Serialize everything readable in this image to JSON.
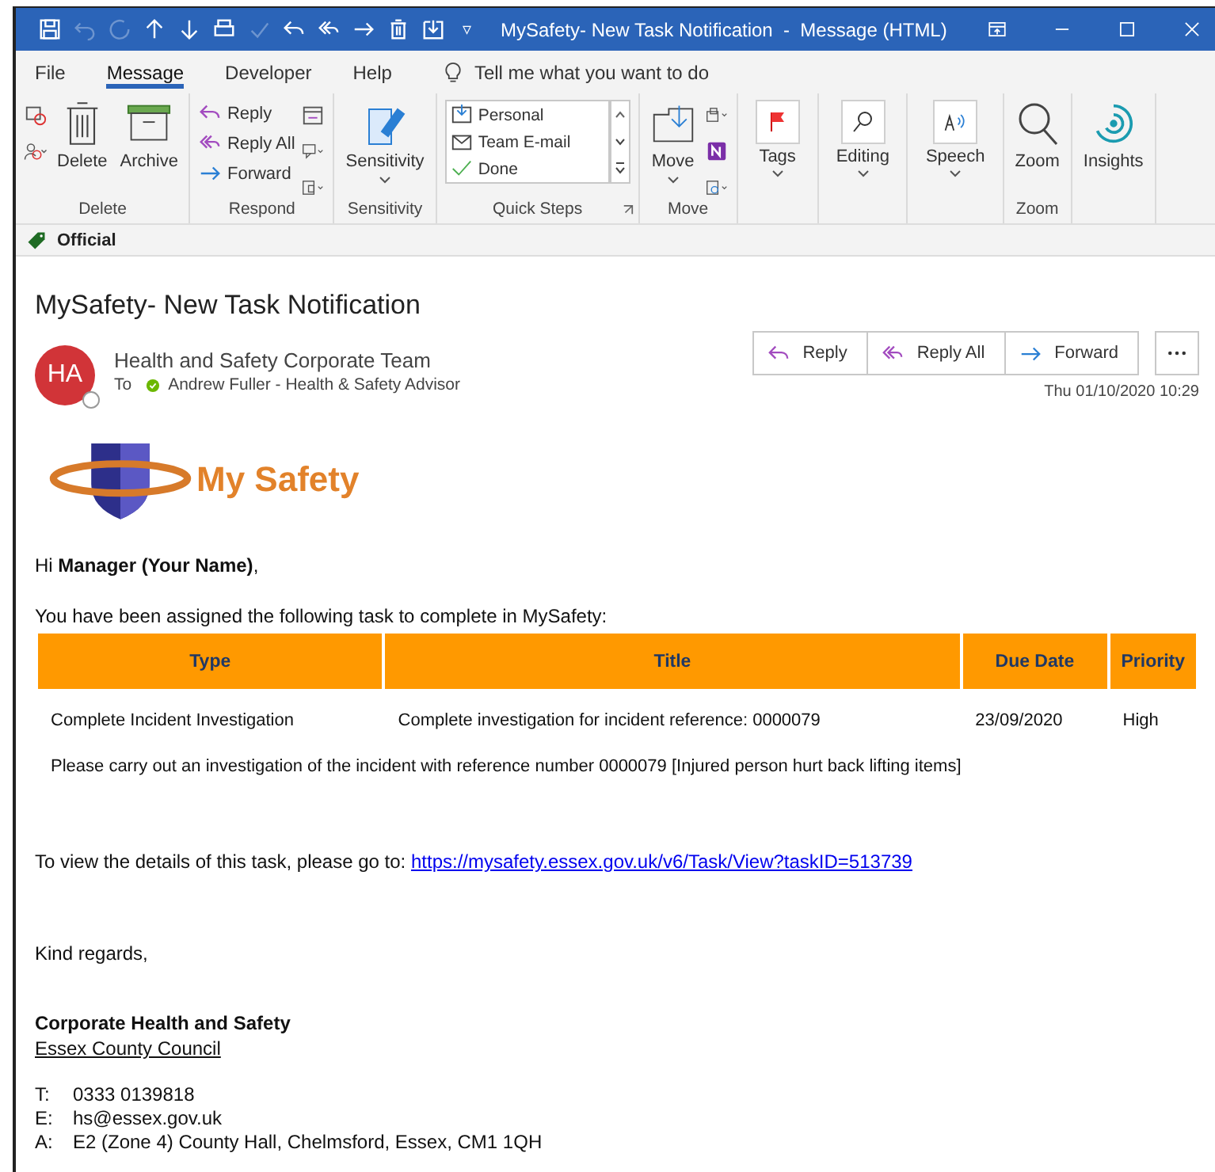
{
  "window": {
    "title": "MySafety- New Task Notification  -  Message (HTML)",
    "qat_more": "▿"
  },
  "menu_tabs": [
    {
      "label": "File",
      "selected": false
    },
    {
      "label": "Message",
      "selected": true
    },
    {
      "label": "Developer",
      "selected": false
    },
    {
      "label": "Help",
      "selected": false
    }
  ],
  "tell_me": {
    "placeholder": "Tell me what you want to do"
  },
  "ribbon": {
    "groups": [
      {
        "label": "Delete",
        "kind": "delete",
        "buttons": [
          "Delete",
          "Archive"
        ]
      },
      {
        "label": "Respond",
        "kind": "respond",
        "buttons": [
          "Reply",
          "Reply All",
          "Forward"
        ]
      },
      {
        "label": "Sensitivity",
        "kind": "big",
        "buttons": [
          "Sensitivity"
        ]
      },
      {
        "label": "Quick Steps",
        "kind": "quicksteps",
        "buttons": [
          "Personal",
          "Team E-mail",
          "Done"
        ]
      },
      {
        "label": "Move",
        "kind": "move",
        "buttons": [
          "Move"
        ]
      },
      {
        "kind": "small",
        "buttons": [
          "Tags"
        ]
      },
      {
        "kind": "small",
        "buttons": [
          "Editing"
        ]
      },
      {
        "kind": "small",
        "buttons": [
          "Speech"
        ]
      },
      {
        "label": "Zoom",
        "kind": "big",
        "buttons": [
          "Zoom"
        ]
      },
      {
        "kind": "big",
        "buttons": [
          "Insights"
        ]
      }
    ]
  },
  "classification": "Official",
  "message": {
    "subject": "MySafety- New Task Notification",
    "avatar": "HA",
    "sender": "Health and Safety Corporate Team",
    "to_label": "To",
    "recipient": "Andrew Fuller - Health & Safety Advisor",
    "actions": [
      "Reply",
      "Reply All",
      "Forward"
    ],
    "date": "Thu 01/10/2020 10:29"
  },
  "body": {
    "logo_text": "My Safety",
    "greeting": "Hi **Manager (Your Name)**,",
    "intro": "You have been assigned the following task to complete in MySafety:",
    "table": {
      "columns": [
        "Type",
        "Title",
        "Due Date",
        "Priority"
      ],
      "rows": [
        [
          "Complete Incident Investigation",
          "Complete investigation for incident reference: 0000079",
          "23/09/2020",
          "High"
        ]
      ],
      "description": "Please carry out an investigation of the incident with reference number 0000079 [Injured person hurt back lifting items]"
    },
    "link_prefix": "To view the details of this task, please go to:",
    "link": "https://mysafety.essex.gov.uk/v6/Task/View?taskID=513739",
    "closing": "Kind regards,",
    "signature_name": "Corporate Health and Safety",
    "signature_org": "Essex County Council ",
    "contacts": [
      {
        "label": "T:",
        "value": "0333 0139818"
      },
      {
        "label": "E:",
        "value": "hs@essex.gov.uk"
      },
      {
        "label": "A:",
        "value": "E2 (Zone 4) County Hall, Chelmsford, Essex, CM1 1QH"
      }
    ]
  }
}
